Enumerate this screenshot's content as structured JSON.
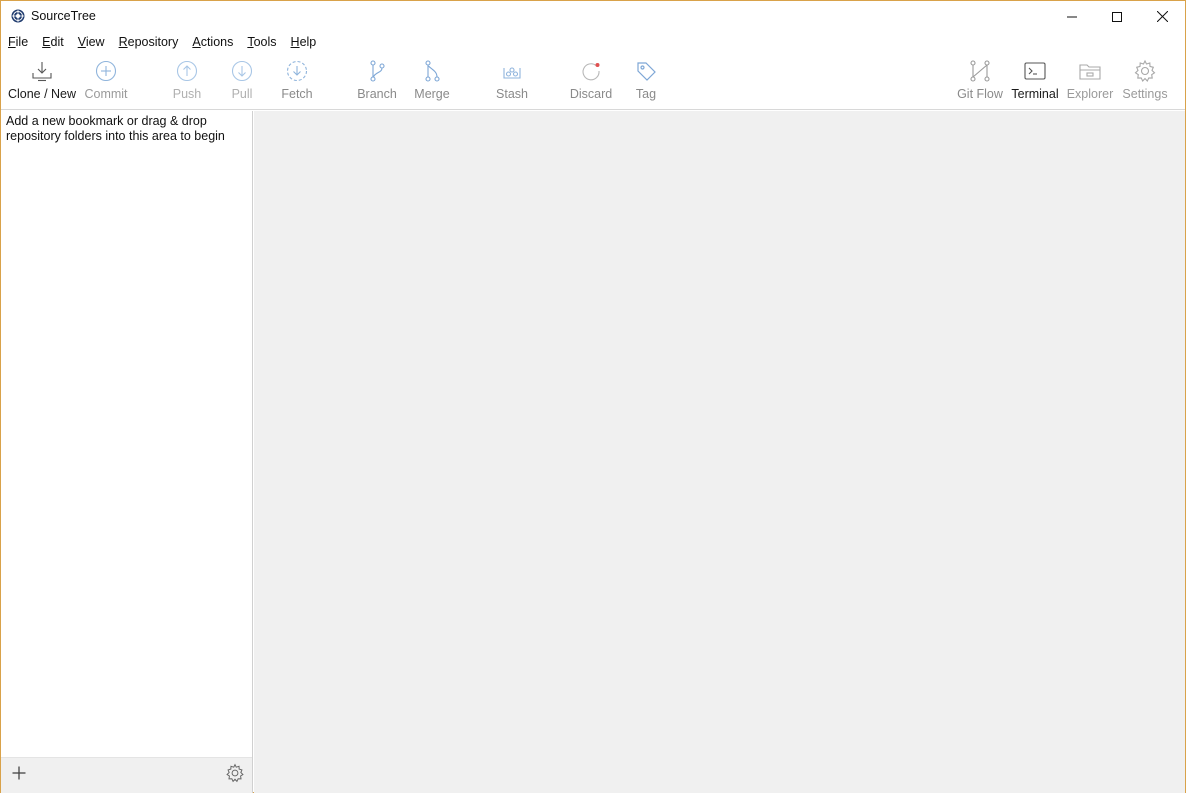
{
  "window": {
    "title": "SourceTree",
    "controls": {
      "minimize": "minimize-icon",
      "maximize": "maximize-icon",
      "close": "close-icon"
    }
  },
  "menu": {
    "items": [
      {
        "label": "File",
        "accel": "F",
        "rest": "ile"
      },
      {
        "label": "Edit",
        "accel": "E",
        "rest": "dit"
      },
      {
        "label": "View",
        "accel": "V",
        "rest": "iew"
      },
      {
        "label": "Repository",
        "accel": "R",
        "rest": "epository"
      },
      {
        "label": "Actions",
        "accel": "A",
        "rest": "ctions"
      },
      {
        "label": "Tools",
        "accel": "T",
        "rest": "ools"
      },
      {
        "label": "Help",
        "accel": "H",
        "rest": "elp"
      }
    ]
  },
  "toolbar": {
    "clone_new": "Clone / New",
    "commit": "Commit",
    "push": "Push",
    "pull": "Pull",
    "fetch": "Fetch",
    "branch": "Branch",
    "merge": "Merge",
    "stash": "Stash",
    "discard": "Discard",
    "tag": "Tag",
    "git_flow": "Git Flow",
    "terminal": "Terminal",
    "explorer": "Explorer",
    "settings": "Settings"
  },
  "sidebar": {
    "hint": "Add a new bookmark or drag & drop repository folders into this area to begin"
  },
  "colors": {
    "accent_blue": "#6fa8dc",
    "disabled_gray": "#9a9a9a",
    "discard_red": "#e05050",
    "main_bg": "#f0f0f0"
  }
}
